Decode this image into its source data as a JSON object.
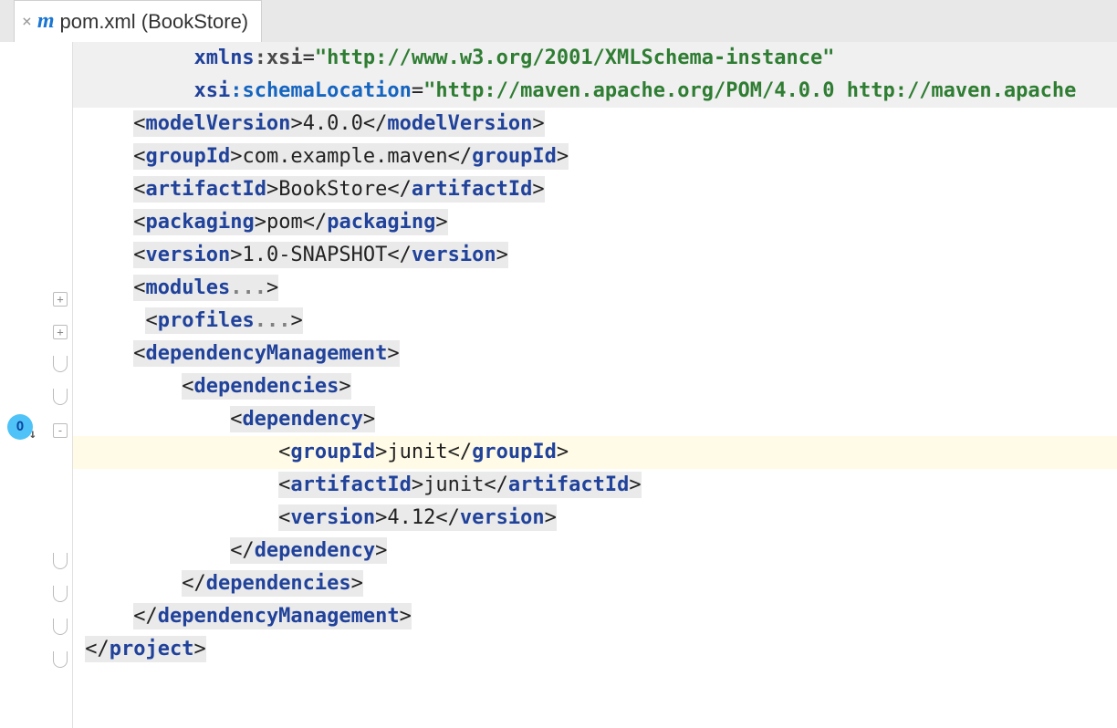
{
  "tab": {
    "title": "pom.xml (BookStore)"
  },
  "code": {
    "l0": {
      "nsPrefix": "xmlns",
      "nsLocal": ":xsi",
      "eq": "=",
      "val": "\"http://www.w3.org/2001/XMLSchema-instance\""
    },
    "l1": {
      "nsPrefix": "xsi",
      "nsLocal": ":schemaLocation",
      "eq": "=",
      "val": "\"http://maven.apache.org/POM/4.0.0 http://maven.apache"
    },
    "l2": {
      "open": "<",
      "tag": "modelVersion",
      "gt": ">",
      "text": "4.0.0",
      "lt2": "</",
      "tag2": "modelVersion",
      "end": ">"
    },
    "l3": {
      "open": "<",
      "tag": "groupId",
      "gt": ">",
      "text": "com.example.maven",
      "lt2": "</",
      "tag2": "groupId",
      "end": ">"
    },
    "l4": {
      "open": "<",
      "tag": "artifactId",
      "gt": ">",
      "text": "BookStore",
      "lt2": "</",
      "tag2": "artifactId",
      "end": ">"
    },
    "l5": {
      "open": "<",
      "tag": "packaging",
      "gt": ">",
      "text": "pom",
      "lt2": "</",
      "tag2": "packaging",
      "end": ">"
    },
    "l6": {
      "open": "<",
      "tag": "version",
      "gt": ">",
      "text": "1.0-SNAPSHOT",
      "lt2": "</",
      "tag2": "version",
      "end": ">"
    },
    "l7": {
      "open": "<",
      "tag": "modules",
      "fold": "...",
      "end": ">"
    },
    "l8": {
      "open": "<",
      "tag": "profiles",
      "fold": "...",
      "end": ">"
    },
    "l9": {
      "open": "<",
      "tag": "dependencyManagement",
      "end": ">"
    },
    "l10": {
      "open": "<",
      "tag": "dependencies",
      "end": ">"
    },
    "l11": {
      "open": "<",
      "tag": "dependency",
      "end": ">"
    },
    "l12": {
      "open": "<",
      "tag": "groupId",
      "gt": ">",
      "text": "junit",
      "lt2": "</",
      "tag2": "groupId",
      "end": ">"
    },
    "l13": {
      "open": "<",
      "tag": "artifactId",
      "gt": ">",
      "text": "junit",
      "lt2": "</",
      "tag2": "artifactId",
      "end": ">"
    },
    "l14": {
      "open": "<",
      "tag": "version",
      "gt": ">",
      "text": "4.12",
      "lt2": "</",
      "tag2": "version",
      "end": ">"
    },
    "l15": {
      "open": "</",
      "tag": "dependency",
      "end": ">"
    },
    "l16": {
      "open": "</",
      "tag": "dependencies",
      "end": ">"
    },
    "l17": {
      "open": "</",
      "tag": "dependencyManagement",
      "end": ">"
    },
    "l18": {
      "open": "</",
      "tag": "project",
      "end": ">"
    }
  },
  "gutter": {
    "expand1": "+",
    "expand2": "+",
    "collapse1": "-",
    "collapse2": "-",
    "collapse3": "-"
  }
}
